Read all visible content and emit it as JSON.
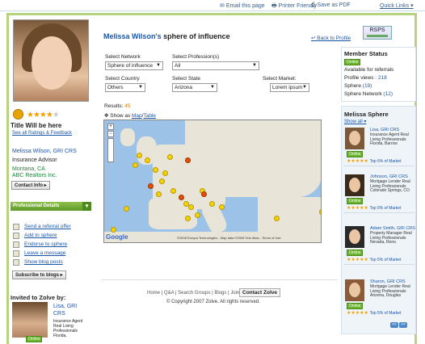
{
  "topbar": {
    "email": "Email this page",
    "printer": "Printer Friendly",
    "pdf": "Save as PDF",
    "quick_links": "Quick Links"
  },
  "profile": {
    "title": "Title Will be here",
    "see_all": "See all Ratings & Feedback",
    "name": "Melissa Wilson, GRI CRS",
    "role": "Insurance Advisor",
    "location": "Montana, CA",
    "company": "ABC Realtors Inc.",
    "contact_btn": "Contact Info",
    "rating_on": 4,
    "rating_total": 5
  },
  "professional_details": "Professional Details",
  "actions": [
    "Send a referral offer",
    "Add to sphere",
    "Endorse to sphere",
    "Leave a message",
    "Show blog posts"
  ],
  "subscribe": "Subscribe to blogs",
  "invited": {
    "title": "Invited to Zolve by:",
    "name": "Lisa, GRI CRS",
    "text": "Insurance Agent Real Living Professionals Florida,",
    "online": "Online"
  },
  "center": {
    "name": "Melissa Wilson's",
    "rest": "sphere of influence",
    "back": "Back to Profile",
    "logo": "RSPS"
  },
  "filters": {
    "network_label": "Select Network",
    "network_value": "Sphere of influence",
    "profession_label": "Select Profession(s)",
    "profession_value": "All",
    "country_label": "Select Country",
    "country_value": "Others",
    "state_label": "Select State",
    "state_value": "Arizona",
    "market_label": "Select Market:",
    "market_value": "Lorem ipsum"
  },
  "results": {
    "label": "Results:",
    "count": "45",
    "show_as": "Show as",
    "map": "Map",
    "sep": "/",
    "table": "Table"
  },
  "map": {
    "google": "Google",
    "copyright": "©2008 Europa Technologies - Map data ©2008 Tele Atlas - Terms of Use"
  },
  "member_status": {
    "title": "Member Status",
    "online": "Online",
    "available": "Available for referrals",
    "views_label": "Profile views :",
    "views": "218",
    "sphere_label": "Sphere",
    "sphere": "(19)",
    "network_label": "Sphere Network",
    "network": "(12)"
  },
  "sphere": {
    "title": "Melissa Sphere",
    "show_all": "Show all",
    "cards": [
      {
        "name": "Lisa, GRI CRS",
        "text": "Insurance Agent Real Living Professionals Florida, Barrow",
        "online": "Online",
        "top": "Top 5% of Market"
      },
      {
        "name": "Johnson, GRI CRS",
        "text": "Mortgage Lender Real Living Professionals Colorado Springs, CO",
        "online": "Online",
        "top": "Top 5% of Market"
      },
      {
        "name": "Adam Smith, GRI CRS",
        "text": "Property Manager Real Living Professionals Nevada, Reno.",
        "online": "Online",
        "top": "Top 5% of Market"
      },
      {
        "name": "Sharon, GRI CRS",
        "text": "Mortgage Lender Real Living Professionals Arizona, Douglas",
        "online": "Online",
        "top": "Top 5% of Market"
      }
    ],
    "pager": [
      "<<",
      ">>"
    ]
  },
  "footer": {
    "links": "Home | Q&A | Search Groups | Blogs | Join |",
    "contact": "Contact Zolve",
    "copyright": "© Copyright 2007 Zolve. All rights reserved."
  }
}
